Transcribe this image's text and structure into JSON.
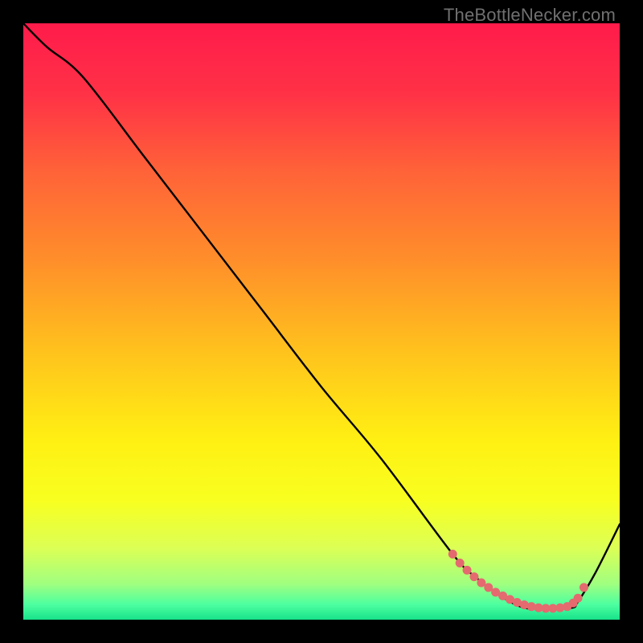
{
  "attribution": "TheBottleNecker.com",
  "gradient": {
    "stops": [
      {
        "offset": 0.0,
        "color": "#ff1b4b"
      },
      {
        "offset": 0.12,
        "color": "#ff3246"
      },
      {
        "offset": 0.25,
        "color": "#ff6338"
      },
      {
        "offset": 0.4,
        "color": "#ff8f2a"
      },
      {
        "offset": 0.55,
        "color": "#ffc21d"
      },
      {
        "offset": 0.7,
        "color": "#fff013"
      },
      {
        "offset": 0.8,
        "color": "#f8ff20"
      },
      {
        "offset": 0.88,
        "color": "#dcff55"
      },
      {
        "offset": 0.94,
        "color": "#a0ff80"
      },
      {
        "offset": 0.975,
        "color": "#4cffa0"
      },
      {
        "offset": 1.0,
        "color": "#18e28a"
      }
    ]
  },
  "chart_data": {
    "type": "line",
    "title": "",
    "xlabel": "",
    "ylabel": "",
    "xlim": [
      0,
      100
    ],
    "ylim": [
      0,
      100
    ],
    "series": [
      {
        "name": "curve",
        "x": [
          0,
          4,
          10,
          20,
          30,
          40,
          50,
          60,
          72,
          76,
          80,
          84,
          88,
          92,
          93,
          96,
          100
        ],
        "y": [
          100,
          96,
          91,
          78,
          65,
          52,
          39,
          27,
          11,
          7,
          4,
          2,
          2,
          2,
          3,
          8,
          16
        ]
      }
    ],
    "markers": {
      "name": "dotted-markers",
      "color": "#e46a6f",
      "points_x": [
        72.0,
        73.2,
        74.4,
        75.6,
        76.8,
        78.0,
        79.2,
        80.4,
        81.6,
        82.8,
        84.0,
        85.2,
        86.4,
        87.6,
        88.8,
        90.0,
        91.2,
        92.2,
        93.0,
        94.0
      ],
      "points_y": [
        11.0,
        9.5,
        8.3,
        7.2,
        6.2,
        5.4,
        4.6,
        4.0,
        3.4,
        2.9,
        2.5,
        2.2,
        2.0,
        1.9,
        1.9,
        2.0,
        2.2,
        2.8,
        3.6,
        5.4
      ]
    }
  }
}
